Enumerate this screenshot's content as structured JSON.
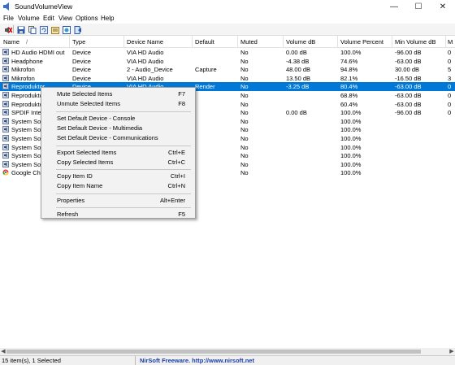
{
  "window": {
    "title": "SoundVolumeView",
    "minimize": "—",
    "maximize": "☐",
    "close": "✕"
  },
  "menu": [
    "File",
    "Volume",
    "Edit",
    "View",
    "Options",
    "Help"
  ],
  "toolbar": [
    "mute-device-icon",
    "save-icon",
    "copy-icon",
    "refresh-icon",
    "properties-icon",
    "html-report-icon",
    "exit-icon"
  ],
  "columns": [
    "Name",
    "Type",
    "Device Name",
    "Default",
    "Muted",
    "Volume dB",
    "Volume Percent",
    "Min Volume dB",
    "M"
  ],
  "sort_indicator": "/",
  "rows": [
    {
      "name": "HD Audio HDMI out",
      "type": "Device",
      "device": "VIA HD Audio",
      "default": "",
      "muted": "No",
      "vol_db": "0.00 dB",
      "vol_pct": "100.0%",
      "min_db": "-96.00 dB",
      "m": "0"
    },
    {
      "name": "Headphone",
      "type": "Device",
      "device": "VIA HD Audio",
      "default": "",
      "muted": "No",
      "vol_db": "-4.38 dB",
      "vol_pct": "74.6%",
      "min_db": "-63.00 dB",
      "m": "0"
    },
    {
      "name": "Mikrofon",
      "type": "Device",
      "device": "2 - Audio_Device",
      "default": "Capture",
      "muted": "No",
      "vol_db": "48.00 dB",
      "vol_pct": "94.8%",
      "min_db": "30.00 dB",
      "m": "5"
    },
    {
      "name": "Mikrofon",
      "type": "Device",
      "device": "VIA HD Audio",
      "default": "",
      "muted": "No",
      "vol_db": "13.50 dB",
      "vol_pct": "82.1%",
      "min_db": "-16.50 dB",
      "m": "3"
    },
    {
      "name": "Reproduktor",
      "type": "Device",
      "device": "VIA HD Audio",
      "default": "Render",
      "muted": "No",
      "vol_db": "-3.25 dB",
      "vol_pct": "80.4%",
      "min_db": "-63.00 dB",
      "m": "0"
    },
    {
      "name": "Reproduktor",
      "type": "",
      "device": "",
      "default": "",
      "muted": "No",
      "vol_db": "",
      "vol_pct": "68.8%",
      "min_db": "-63.00 dB",
      "m": "0"
    },
    {
      "name": "Reproduktor",
      "type": "",
      "device": "",
      "default": "",
      "muted": "No",
      "vol_db": "",
      "vol_pct": "60.4%",
      "min_db": "-63.00 dB",
      "m": "0"
    },
    {
      "name": "SPDIF Interfa",
      "type": "",
      "device": "",
      "default": "",
      "muted": "No",
      "vol_db": "0.00 dB",
      "vol_pct": "100.0%",
      "min_db": "-96.00 dB",
      "m": "0"
    },
    {
      "name": "System Soun",
      "type": "",
      "device": "",
      "default": "",
      "muted": "No",
      "vol_db": "",
      "vol_pct": "100.0%",
      "min_db": "",
      "m": ""
    },
    {
      "name": "System Soun",
      "type": "",
      "device": "",
      "default": "",
      "muted": "No",
      "vol_db": "",
      "vol_pct": "100.0%",
      "min_db": "",
      "m": ""
    },
    {
      "name": "System Soun",
      "type": "",
      "device": "",
      "default": "",
      "muted": "No",
      "vol_db": "",
      "vol_pct": "100.0%",
      "min_db": "",
      "m": ""
    },
    {
      "name": "System Soun",
      "type": "",
      "device": "",
      "default": "",
      "muted": "No",
      "vol_db": "",
      "vol_pct": "100.0%",
      "min_db": "",
      "m": ""
    },
    {
      "name": "System Soun",
      "type": "",
      "device": "",
      "default": "",
      "muted": "No",
      "vol_db": "",
      "vol_pct": "100.0%",
      "min_db": "",
      "m": ""
    },
    {
      "name": "System Soun",
      "type": "",
      "device": "",
      "default": "",
      "muted": "No",
      "vol_db": "",
      "vol_pct": "100.0%",
      "min_db": "",
      "m": ""
    },
    {
      "name": "Google Chro",
      "type": "",
      "device": "",
      "default": "",
      "muted": "No",
      "vol_db": "",
      "vol_pct": "100.0%",
      "min_db": "",
      "m": ""
    }
  ],
  "context_menu": [
    {
      "label": "Mute Selected Items",
      "key": "F7"
    },
    {
      "label": "Unmute Selected Items",
      "key": "F8"
    },
    {
      "sep": true
    },
    {
      "label": "Set Default Device - Console",
      "key": ""
    },
    {
      "label": "Set Default Device - Multimedia",
      "key": ""
    },
    {
      "label": "Set Default Device - Communications",
      "key": ""
    },
    {
      "sep": true
    },
    {
      "label": "Export Selected Items",
      "key": "Ctrl+E"
    },
    {
      "label": "Copy Selected Items",
      "key": "Ctrl+C"
    },
    {
      "sep": true
    },
    {
      "label": "Copy Item ID",
      "key": "Ctrl+I"
    },
    {
      "label": "Copy Item Name",
      "key": "Ctrl+N"
    },
    {
      "sep": true
    },
    {
      "label": "Properties",
      "key": "Alt+Enter"
    },
    {
      "sep": true
    },
    {
      "label": "Refresh",
      "key": "F5"
    }
  ],
  "status": {
    "count": "15 item(s), 1 Selected",
    "credit": "NirSoft Freeware.  http://www.nirsoft.net"
  },
  "colors": {
    "selection": "#0078d7",
    "credit": "#1a3ea6"
  }
}
